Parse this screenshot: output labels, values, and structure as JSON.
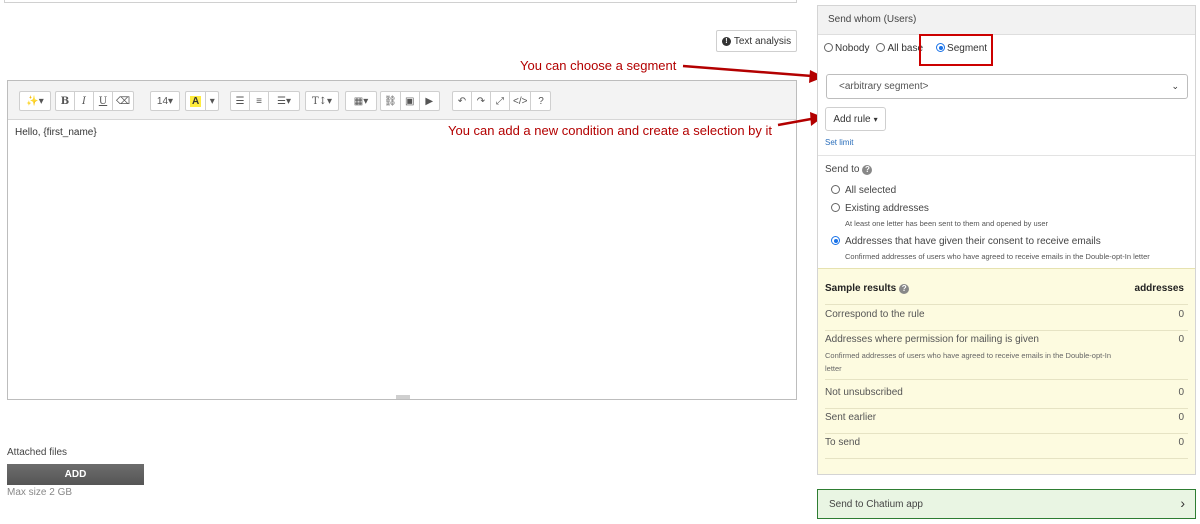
{
  "toolbar": {
    "font_size": "14",
    "highlight": "A",
    "bold": "B",
    "italic": "I",
    "underline": "U",
    "help": "?"
  },
  "text_analysis": {
    "label": "Text analysis"
  },
  "editor": {
    "content": "Hello, {first_name}"
  },
  "attachments": {
    "label": "Attached files",
    "add_button": "ADD",
    "max_size": "Max size 2 GB"
  },
  "annotations": {
    "segment": "You can choose a segment",
    "condition": "You can add a new condition and create a selection by it"
  },
  "panel": {
    "header": "Send whom (Users)",
    "radios": {
      "nobody": "Nobody",
      "all_base": "All base",
      "segment": "Segment"
    },
    "segment_select": "<arbitrary segment>",
    "add_rule": "Add rule",
    "set_limit": "Set limit",
    "send_to_label": "Send to",
    "send_options": [
      {
        "label": "All selected",
        "sub": ""
      },
      {
        "label": "Existing addresses",
        "sub": "At least one letter has been sent to them and opened by user"
      },
      {
        "label": "Addresses that have given their consent to receive emails",
        "sub": "Confirmed addresses of users who have agreed to receive emails in the Double-opt-In letter"
      }
    ],
    "results": {
      "title": "Sample results",
      "column": "addresses",
      "rows": [
        {
          "label": "Correspond to the rule",
          "value": "0"
        },
        {
          "label": "Addresses where permission for mailing is given",
          "sub": "Confirmed addresses of users who have agreed to receive emails in the Double-opt-In letter",
          "value": "0"
        },
        {
          "label": "Not unsubscribed",
          "value": "0"
        },
        {
          "label": "Sent earlier",
          "value": "0"
        },
        {
          "label": "To send",
          "value": "0"
        }
      ]
    }
  },
  "chatium": {
    "label": "Send to Chatium app"
  },
  "colors": {
    "annotation": "#b30000",
    "highlight_border": "#cc0000",
    "results_bg": "#fdfbe0",
    "chatium_border": "#2e7d32",
    "link": "#2a6ebb"
  }
}
